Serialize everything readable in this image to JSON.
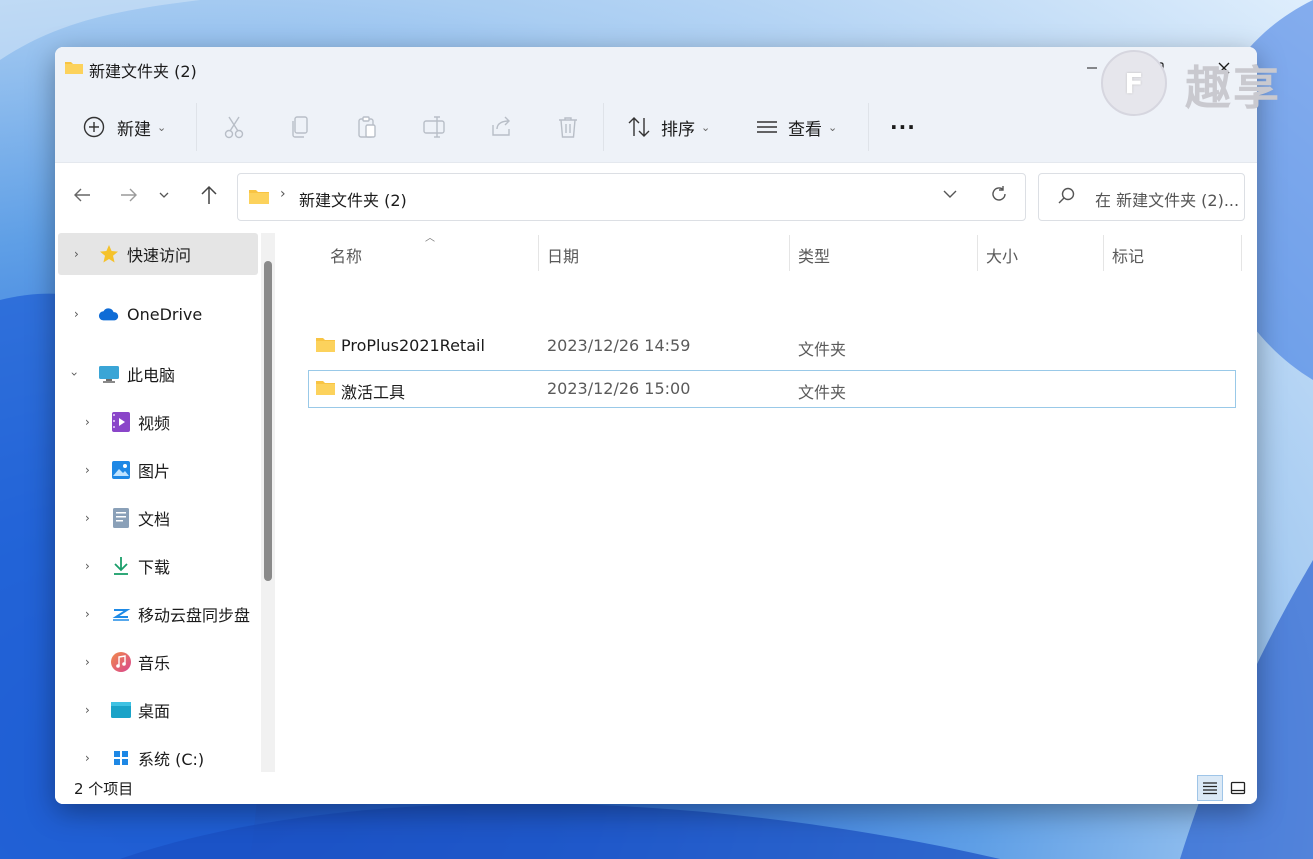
{
  "window": {
    "title": "新建文件夹 (2)"
  },
  "toolbar": {
    "new_label": "新建",
    "sort_label": "排序",
    "view_label": "查看",
    "more_label": "···"
  },
  "address": {
    "path": "新建文件夹 (2)"
  },
  "search": {
    "placeholder": "在 新建文件夹 (2)..."
  },
  "sidebar": {
    "items": [
      {
        "label": "快速访问",
        "icon": "star-icon"
      },
      {
        "label": "OneDrive",
        "icon": "cloud-icon"
      },
      {
        "label": "此电脑",
        "icon": "monitor-icon"
      },
      {
        "label": "视频",
        "icon": "video-icon"
      },
      {
        "label": "图片",
        "icon": "picture-icon"
      },
      {
        "label": "文档",
        "icon": "document-icon"
      },
      {
        "label": "下载",
        "icon": "download-icon"
      },
      {
        "label": "移动云盘同步盘",
        "icon": "mobile-cloud-icon"
      },
      {
        "label": "音乐",
        "icon": "music-icon"
      },
      {
        "label": "桌面",
        "icon": "desktop-icon"
      },
      {
        "label": "系统 (C:)",
        "icon": "windows-drive-icon"
      }
    ]
  },
  "columns": {
    "name": "名称",
    "date": "日期",
    "type": "类型",
    "size": "大小",
    "tag": "标记"
  },
  "files": [
    {
      "name": "ProPlus2021Retail",
      "date": "2023/12/26 14:59",
      "type": "文件夹",
      "size": ""
    },
    {
      "name": "激活工具",
      "date": "2023/12/26 15:00",
      "type": "文件夹",
      "size": ""
    }
  ],
  "status": {
    "count": "2 个项目"
  },
  "watermark": {
    "letter": "F",
    "text": "趣享"
  },
  "colors": {
    "folder": "#f8c443",
    "accent": "#0067c0",
    "selection_border": "#99c9e8"
  }
}
